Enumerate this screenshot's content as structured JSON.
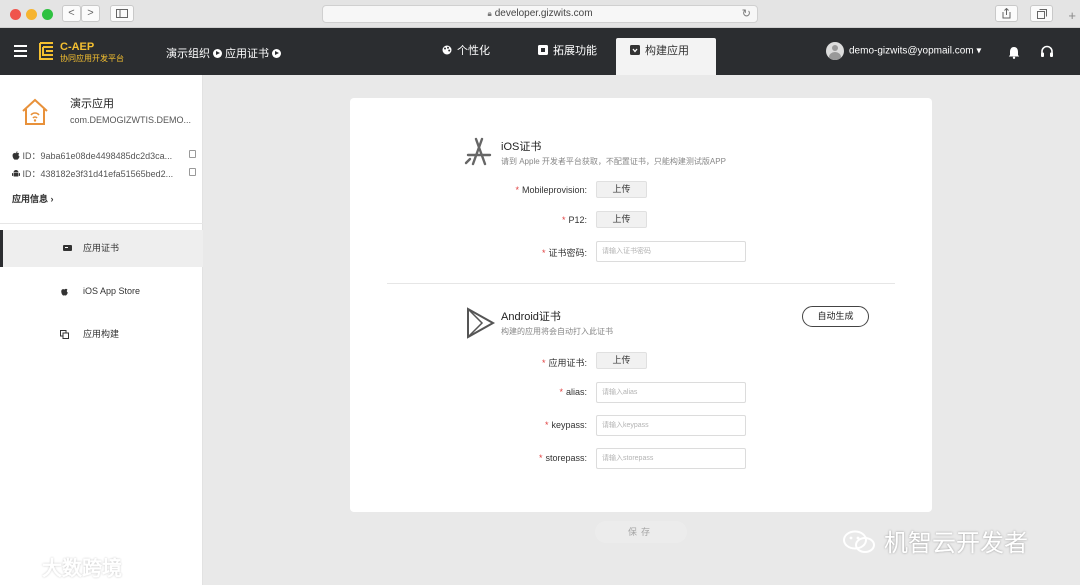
{
  "browser": {
    "url": "developer.gizwits.com",
    "back_icon": "<",
    "forward_icon": ">"
  },
  "header": {
    "brand_title": "C-AEP",
    "brand_subtitle": "协同应用开发平台",
    "breadcrumb": [
      "演示组织",
      "应用证书"
    ],
    "nav_tabs": [
      {
        "label": "个性化",
        "icon": "palette-icon"
      },
      {
        "label": "拓展功能",
        "icon": "puzzle-icon"
      },
      {
        "label": "构建应用",
        "icon": "build-icon",
        "active": true
      }
    ],
    "user_email": "demo-gizwits@yopmail.com",
    "user_caret": "▾",
    "colors": {
      "bar": "#2b2d30",
      "brand": "#f5c030"
    }
  },
  "sidebar": {
    "app_name": "演示应用",
    "app_package": "com.DEMOGIZWTIS.DEMO...",
    "ios_id": "ID：9aba61e08de4498485dc2d3ca...",
    "android_id": "ID：438182e3f31d41efa51565bed2...",
    "app_info_label": "应用信息",
    "items": [
      {
        "label": "应用证书",
        "icon": "certificate-icon",
        "active": true
      },
      {
        "label": "iOS App Store",
        "icon": "apple-icon"
      },
      {
        "label": "应用构建",
        "icon": "copy-icon"
      }
    ]
  },
  "ios": {
    "title": "iOS证书",
    "subtitle": "请到 Apple 开发者平台获取，不配置证书，只能构建测试版APP",
    "mobileprovision_label": "Mobileprovision:",
    "p12_label": "P12:",
    "password_label": "证书密码:",
    "upload_label": "上传",
    "password_placeholder": "请输入证书密码"
  },
  "android": {
    "title": "Android证书",
    "subtitle": "构建的应用将会自动打入此证书",
    "auto_generate_label": "自动生成",
    "cert_label": "应用证书:",
    "upload_label": "上传",
    "alias_label": "alias:",
    "alias_placeholder": "请输入alias",
    "keypass_label": "keypass:",
    "keypass_placeholder": "请输入keypass",
    "storepass_label": "storepass:",
    "storepass_placeholder": "请输入storepass"
  },
  "save_label": "保存",
  "required_mark": "*",
  "watermarks": {
    "left": "大数跨境",
    "right": "机智云开发者"
  }
}
